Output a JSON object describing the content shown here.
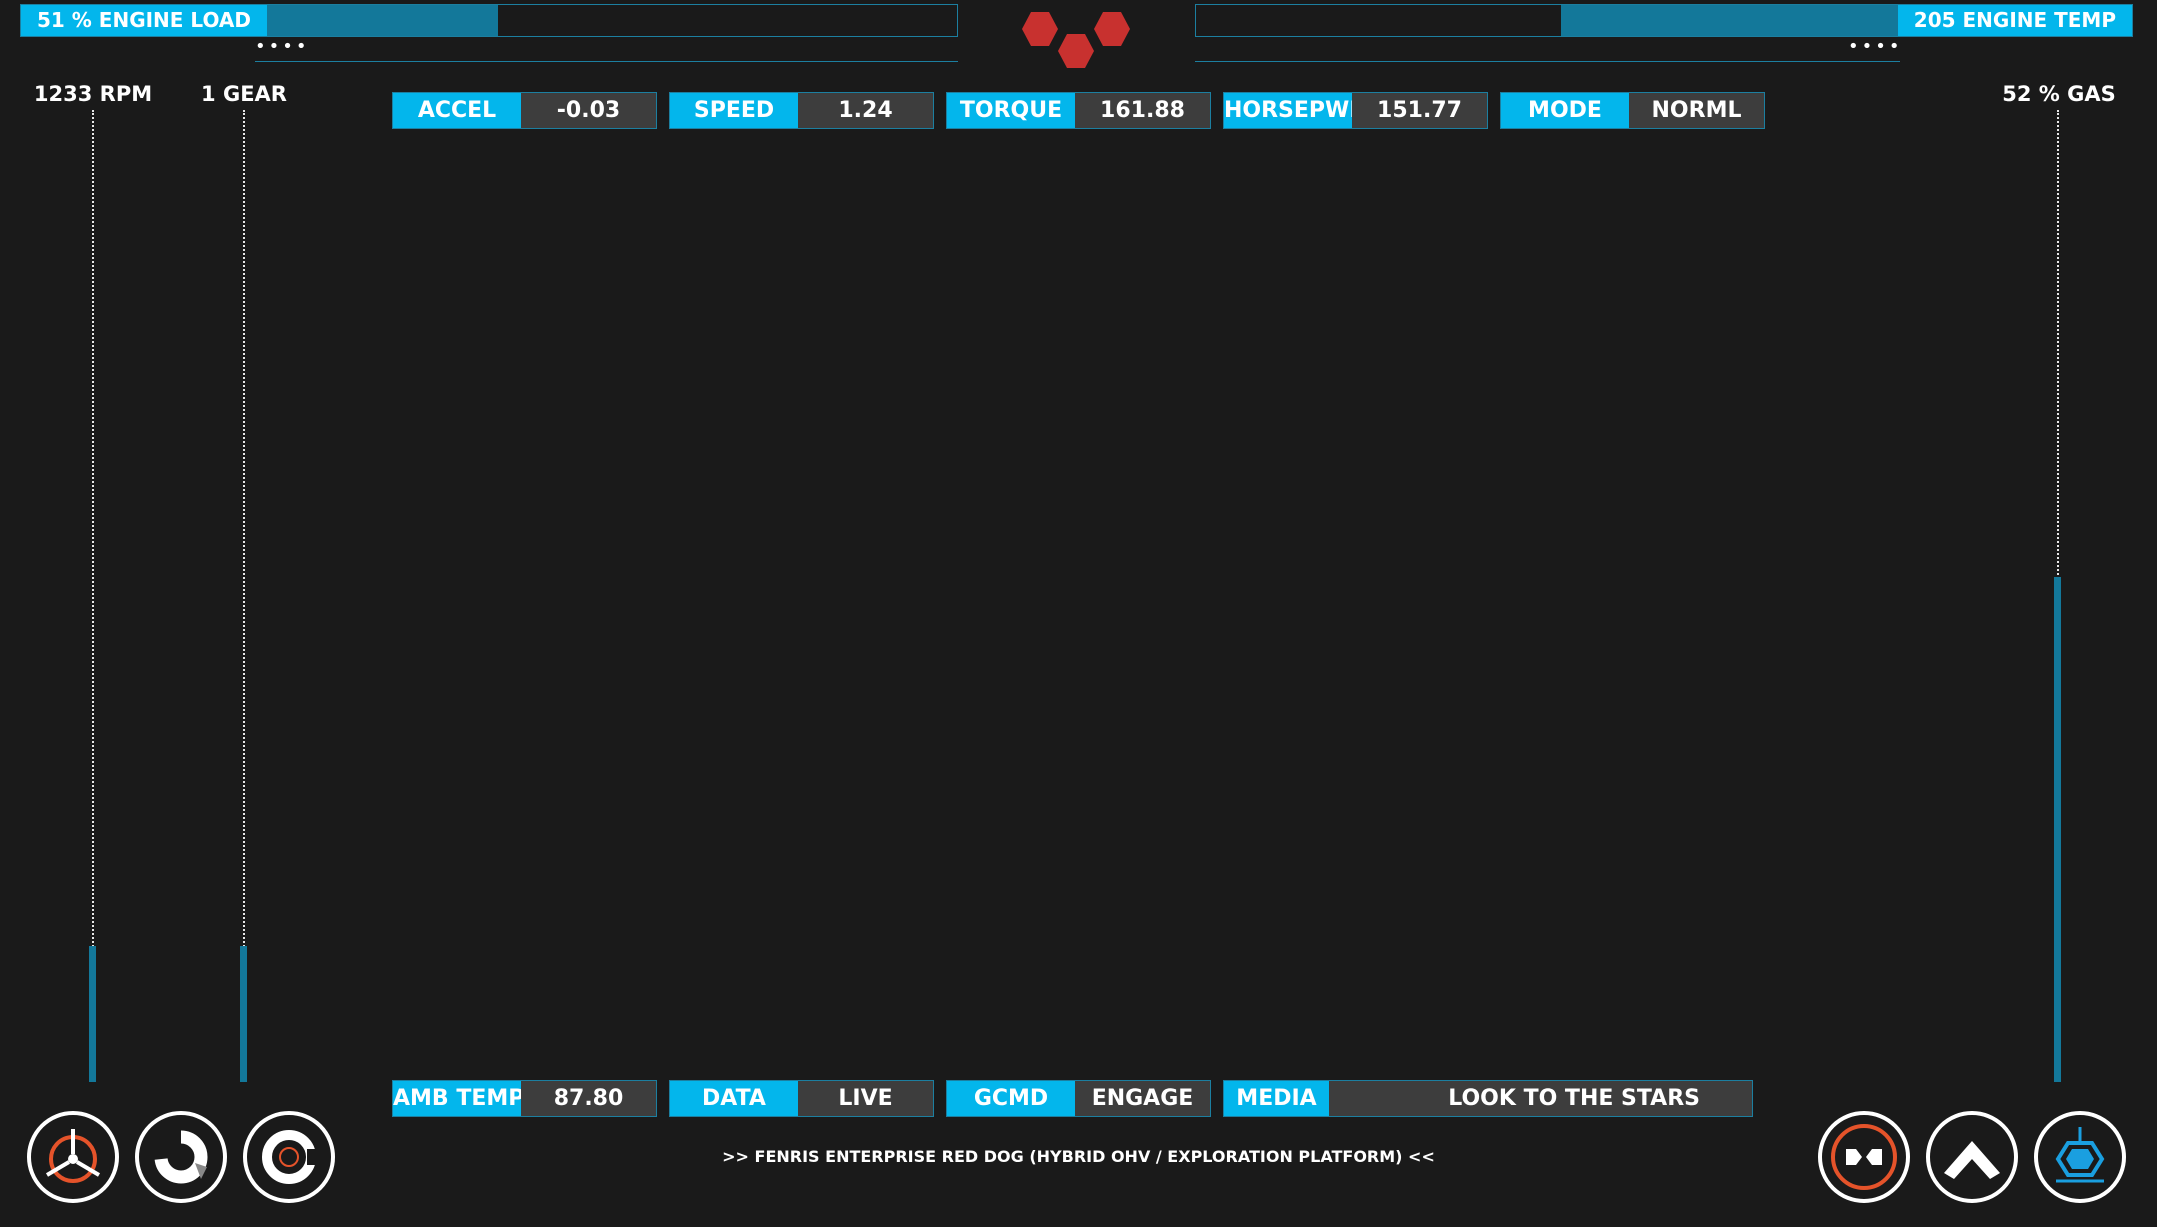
{
  "top": {
    "engine_load": {
      "label": "51 % ENGINE LOAD",
      "value_fraction": 0.51
    },
    "engine_temp": {
      "label": "205 ENGINE TEMP",
      "value_fraction": 0.61
    },
    "dots_left": "••••",
    "dots_right": "••••"
  },
  "gauges": {
    "rpm": {
      "label": "1233 RPM",
      "level_fraction": 0.14
    },
    "gear": {
      "label": "1 GEAR",
      "level_fraction": 0.14
    },
    "gas": {
      "label": "52 % GAS",
      "level_fraction": 0.52
    }
  },
  "stats_top": [
    {
      "key": "ACCEL",
      "value": "-0.03"
    },
    {
      "key": "SPEED",
      "value": "1.24"
    },
    {
      "key": "TORQUE",
      "value": "161.88"
    },
    {
      "key": "HORSEPWR",
      "value": "151.77"
    },
    {
      "key": "MODE",
      "value": "NORML"
    }
  ],
  "stats_bottom": [
    {
      "key": "AMB TEMP",
      "value": "87.80"
    },
    {
      "key": "DATA",
      "value": "LIVE"
    },
    {
      "key": "GCMD",
      "value": "ENGAGE"
    },
    {
      "key": "MEDIA",
      "value": "LOOK TO THE STARS"
    }
  ],
  "footer_text": ">> FENRIS ENTERPRISE RED DOG (HYBRID OHV / EXPLORATION PLATFORM) <<",
  "buttons": {
    "left": [
      "steering-wheel-icon",
      "donut-chart-icon",
      "gear-target-icon"
    ],
    "right": [
      "connect-arrows-icon",
      "chevron-up-icon",
      "hexagon-platform-icon"
    ]
  },
  "colors": {
    "background": "#1a1a1a",
    "accent": "#03b6ec",
    "bar_fill": "#13789a",
    "value_bg": "#3d3d3d",
    "hex_red": "#c8312f",
    "orange": "#e5532a"
  }
}
